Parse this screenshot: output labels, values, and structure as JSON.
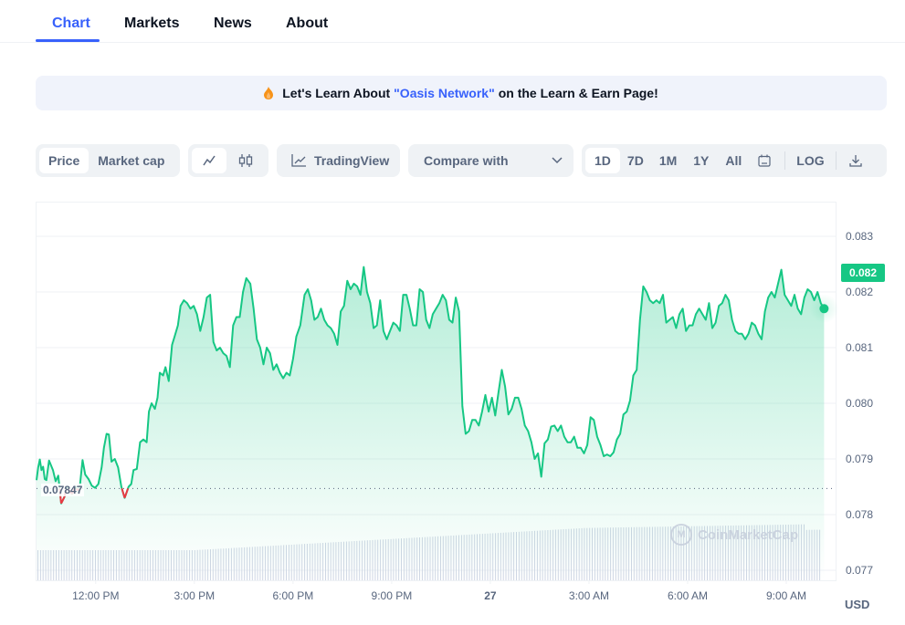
{
  "tabs": [
    {
      "label": "Chart",
      "active": true
    },
    {
      "label": "Markets",
      "active": false
    },
    {
      "label": "News",
      "active": false
    },
    {
      "label": "About",
      "active": false
    }
  ],
  "banner": {
    "icon": "flame-icon",
    "prefix": "Let's Learn About",
    "link": "\"Oasis Network\"",
    "suffix": "on the Learn & Earn Page!"
  },
  "toolbar": {
    "metric_toggle": [
      {
        "label": "Price",
        "active": true
      },
      {
        "label": "Market cap",
        "active": false
      }
    ],
    "chart_type": [
      {
        "icon": "line-chart-icon",
        "active": true
      },
      {
        "icon": "candlestick-icon",
        "active": false
      }
    ],
    "tradingview_label": "TradingView",
    "compare_label": "Compare with",
    "ranges": [
      {
        "label": "1D",
        "active": true
      },
      {
        "label": "7D",
        "active": false
      },
      {
        "label": "1M",
        "active": false
      },
      {
        "label": "1Y",
        "active": false
      },
      {
        "label": "All",
        "active": false
      }
    ],
    "calendar_icon": "calendar-icon",
    "log_label": "LOG",
    "download_icon": "download-icon"
  },
  "colors": {
    "accent": "#3861fb",
    "up": "#16c784",
    "down": "#ea3943",
    "axis_text": "#58667e",
    "volume": "#cfd6e4"
  },
  "chart_data": {
    "type": "area",
    "title": "",
    "xlabel": "",
    "ylabel": "USD",
    "currency_label": "USD",
    "ylim": [
      0.0768,
      0.0836
    ],
    "yticks": [
      "0.083",
      "0.082",
      "0.081",
      "0.080",
      "0.079",
      "0.078",
      "0.077"
    ],
    "ytick_values": [
      0.083,
      0.082,
      0.081,
      0.08,
      0.079,
      0.078,
      0.077
    ],
    "xticks": [
      {
        "label": "12:00 PM",
        "hour": 12,
        "bold": false
      },
      {
        "label": "3:00 PM",
        "hour": 15,
        "bold": false
      },
      {
        "label": "6:00 PM",
        "hour": 18,
        "bold": false
      },
      {
        "label": "9:00 PM",
        "hour": 21,
        "bold": false
      },
      {
        "label": "27",
        "hour": 24,
        "bold": true
      },
      {
        "label": "3:00 AM",
        "hour": 27,
        "bold": false
      },
      {
        "label": "6:00 AM",
        "hour": 30,
        "bold": false
      },
      {
        "label": "9:00 AM",
        "hour": 33,
        "bold": false
      }
    ],
    "xlim_hours": [
      10.2,
      34.5
    ],
    "open_price": 0.07847,
    "open_price_label": "0.07847",
    "current_price_label": "0.082",
    "current_price": 0.08227,
    "grid": true,
    "series": [
      {
        "name": "Price",
        "hours": [
          10.2,
          10.25,
          10.3,
          10.35,
          10.4,
          10.45,
          10.5,
          10.58,
          10.63,
          10.7,
          10.78,
          10.86,
          10.95,
          11.05,
          11.12,
          11.2,
          11.28,
          11.38,
          11.45,
          11.52,
          11.6,
          11.68,
          11.78,
          11.88,
          11.98,
          12.08,
          12.18,
          12.25,
          12.33,
          12.4,
          12.48,
          12.58,
          12.68,
          12.78,
          12.88,
          13.0,
          13.08,
          13.15,
          13.25,
          13.35,
          13.45,
          13.55,
          13.62,
          13.7,
          13.8,
          13.88,
          13.95,
          14.05,
          14.12,
          14.22,
          14.32,
          14.4,
          14.5,
          14.58,
          14.68,
          14.78,
          14.88,
          14.98,
          15.08,
          15.18,
          15.28,
          15.38,
          15.48,
          15.58,
          15.68,
          15.78,
          15.88,
          15.98,
          16.08,
          16.18,
          16.28,
          16.38,
          16.48,
          16.58,
          16.7,
          16.8,
          16.9,
          17.0,
          17.1,
          17.2,
          17.3,
          17.4,
          17.5,
          17.6,
          17.7,
          17.8,
          17.9,
          18.0,
          18.1,
          18.22,
          18.35,
          18.45,
          18.55,
          18.65,
          18.75,
          18.85,
          18.95,
          19.05,
          19.15,
          19.25,
          19.35,
          19.45,
          19.55,
          19.65,
          19.75,
          19.85,
          19.95,
          20.05,
          20.15,
          20.25,
          20.35,
          20.45,
          20.55,
          20.65,
          20.75,
          20.85,
          20.95,
          21.05,
          21.15,
          21.25,
          21.35,
          21.45,
          21.55,
          21.65,
          21.75,
          21.85,
          21.95,
          22.05,
          22.15,
          22.25,
          22.35,
          22.45,
          22.55,
          22.65,
          22.75,
          22.85,
          22.95,
          23.05,
          23.15,
          23.25,
          23.35,
          23.45,
          23.55,
          23.65,
          23.75,
          23.85,
          23.95,
          24.05,
          24.15,
          24.25,
          24.35,
          24.45,
          24.55,
          24.65,
          24.75,
          24.85,
          24.95,
          25.05,
          25.15,
          25.25,
          25.35,
          25.45,
          25.55,
          25.65,
          25.75,
          25.85,
          25.95,
          26.05,
          26.15,
          26.25,
          26.35,
          26.45,
          26.55,
          26.65,
          26.75,
          26.85,
          26.95,
          27.05,
          27.15,
          27.25,
          27.35,
          27.45,
          27.55,
          27.65,
          27.75,
          27.85,
          27.95,
          28.05,
          28.15,
          28.25,
          28.35,
          28.45,
          28.55,
          28.65,
          28.75,
          28.85,
          28.95,
          29.05,
          29.15,
          29.25,
          29.35,
          29.45,
          29.55,
          29.65,
          29.75,
          29.85,
          29.95,
          30.05,
          30.15,
          30.25,
          30.35,
          30.45,
          30.55,
          30.65,
          30.75,
          30.85,
          30.95,
          31.05,
          31.15,
          31.25,
          31.35,
          31.45,
          31.55,
          31.65,
          31.75,
          31.85,
          31.95,
          32.05,
          32.15,
          32.25,
          32.35,
          32.45,
          32.55,
          32.65,
          32.75,
          32.85,
          32.95,
          33.05,
          33.15,
          33.25,
          33.35,
          33.45,
          33.55,
          33.65,
          33.75,
          33.85,
          33.95,
          34.05,
          34.15
        ],
        "values": [
          0.07862,
          0.07885,
          0.07899,
          0.0788,
          0.07886,
          0.07864,
          0.07862,
          0.07897,
          0.0789,
          0.0788,
          0.0786,
          0.0787,
          0.0782,
          0.07832,
          0.0785,
          0.07843,
          0.07837,
          0.0785,
          0.07843,
          0.07852,
          0.07898,
          0.07872,
          0.07864,
          0.07852,
          0.07848,
          0.07855,
          0.07885,
          0.0792,
          0.07945,
          0.07944,
          0.07895,
          0.079,
          0.07885,
          0.0785,
          0.0783,
          0.0785,
          0.07855,
          0.0788,
          0.07882,
          0.0793,
          0.07935,
          0.0793,
          0.07985,
          0.08,
          0.0799,
          0.0801,
          0.08055,
          0.0805,
          0.08065,
          0.0804,
          0.08105,
          0.0812,
          0.0814,
          0.08175,
          0.08185,
          0.0818,
          0.0817,
          0.08175,
          0.0816,
          0.0813,
          0.08155,
          0.0819,
          0.08195,
          0.0811,
          0.08095,
          0.081,
          0.0809,
          0.08085,
          0.08065,
          0.0814,
          0.08155,
          0.08155,
          0.082,
          0.08225,
          0.08215,
          0.0817,
          0.08115,
          0.081,
          0.0807,
          0.081,
          0.0809,
          0.0806,
          0.0807,
          0.08055,
          0.08045,
          0.08055,
          0.0805,
          0.0808,
          0.0812,
          0.0814,
          0.08195,
          0.08205,
          0.08185,
          0.0815,
          0.08155,
          0.0817,
          0.0815,
          0.0814,
          0.08135,
          0.08125,
          0.08105,
          0.08165,
          0.08175,
          0.0822,
          0.08205,
          0.08215,
          0.0821,
          0.08195,
          0.08245,
          0.082,
          0.0818,
          0.08135,
          0.0814,
          0.08185,
          0.0813,
          0.08115,
          0.0813,
          0.08145,
          0.0814,
          0.0813,
          0.08195,
          0.08195,
          0.0817,
          0.0814,
          0.0814,
          0.08205,
          0.082,
          0.0815,
          0.08135,
          0.0816,
          0.0817,
          0.0818,
          0.08195,
          0.08185,
          0.0815,
          0.08145,
          0.0819,
          0.08165,
          0.07995,
          0.07945,
          0.0795,
          0.0797,
          0.0797,
          0.0796,
          0.07985,
          0.08015,
          0.07985,
          0.0801,
          0.07978,
          0.0802,
          0.0806,
          0.0803,
          0.0798,
          0.0799,
          0.0801,
          0.0801,
          0.0799,
          0.0796,
          0.0795,
          0.0793,
          0.079,
          0.0791,
          0.07868,
          0.07928,
          0.07935,
          0.07958,
          0.0796,
          0.0795,
          0.0796,
          0.0794,
          0.0793,
          0.0793,
          0.0794,
          0.0792,
          0.0792,
          0.0791,
          0.07925,
          0.07975,
          0.0797,
          0.0794,
          0.07925,
          0.07905,
          0.07908,
          0.07905,
          0.07912,
          0.07935,
          0.07945,
          0.0798,
          0.07985,
          0.08005,
          0.0805,
          0.0806,
          0.0815,
          0.0821,
          0.082,
          0.08185,
          0.0818,
          0.08185,
          0.0818,
          0.08195,
          0.08145,
          0.0815,
          0.08155,
          0.08135,
          0.0816,
          0.0817,
          0.0813,
          0.0814,
          0.0814,
          0.0816,
          0.0817,
          0.0816,
          0.0815,
          0.0818,
          0.08135,
          0.08145,
          0.08175,
          0.0818,
          0.08195,
          0.08185,
          0.0815,
          0.0813,
          0.08125,
          0.08125,
          0.08115,
          0.08125,
          0.08145,
          0.0814,
          0.08125,
          0.08115,
          0.08165,
          0.0819,
          0.082,
          0.0819,
          0.08215,
          0.0824,
          0.08195,
          0.08185,
          0.08175,
          0.08195,
          0.0817,
          0.0816,
          0.0819,
          0.08205,
          0.082,
          0.08185,
          0.082,
          0.0818,
          0.0817,
          0.0821,
          0.0829,
          0.082,
          0.082,
          0.0823,
          0.0824,
          0.0819,
          0.0823,
          0.0816,
          0.08225,
          0.08275,
          0.08255,
          0.08245,
          0.08225,
          0.08235,
          0.0821,
          0.08195,
          0.08227
        ]
      },
      {
        "name": "Volume",
        "relative_values_note": "relative volume trend (unitless, 0-1 of panel)",
        "start": 0.3,
        "end": 0.56
      }
    ]
  },
  "watermark": "CoinMarketCap"
}
